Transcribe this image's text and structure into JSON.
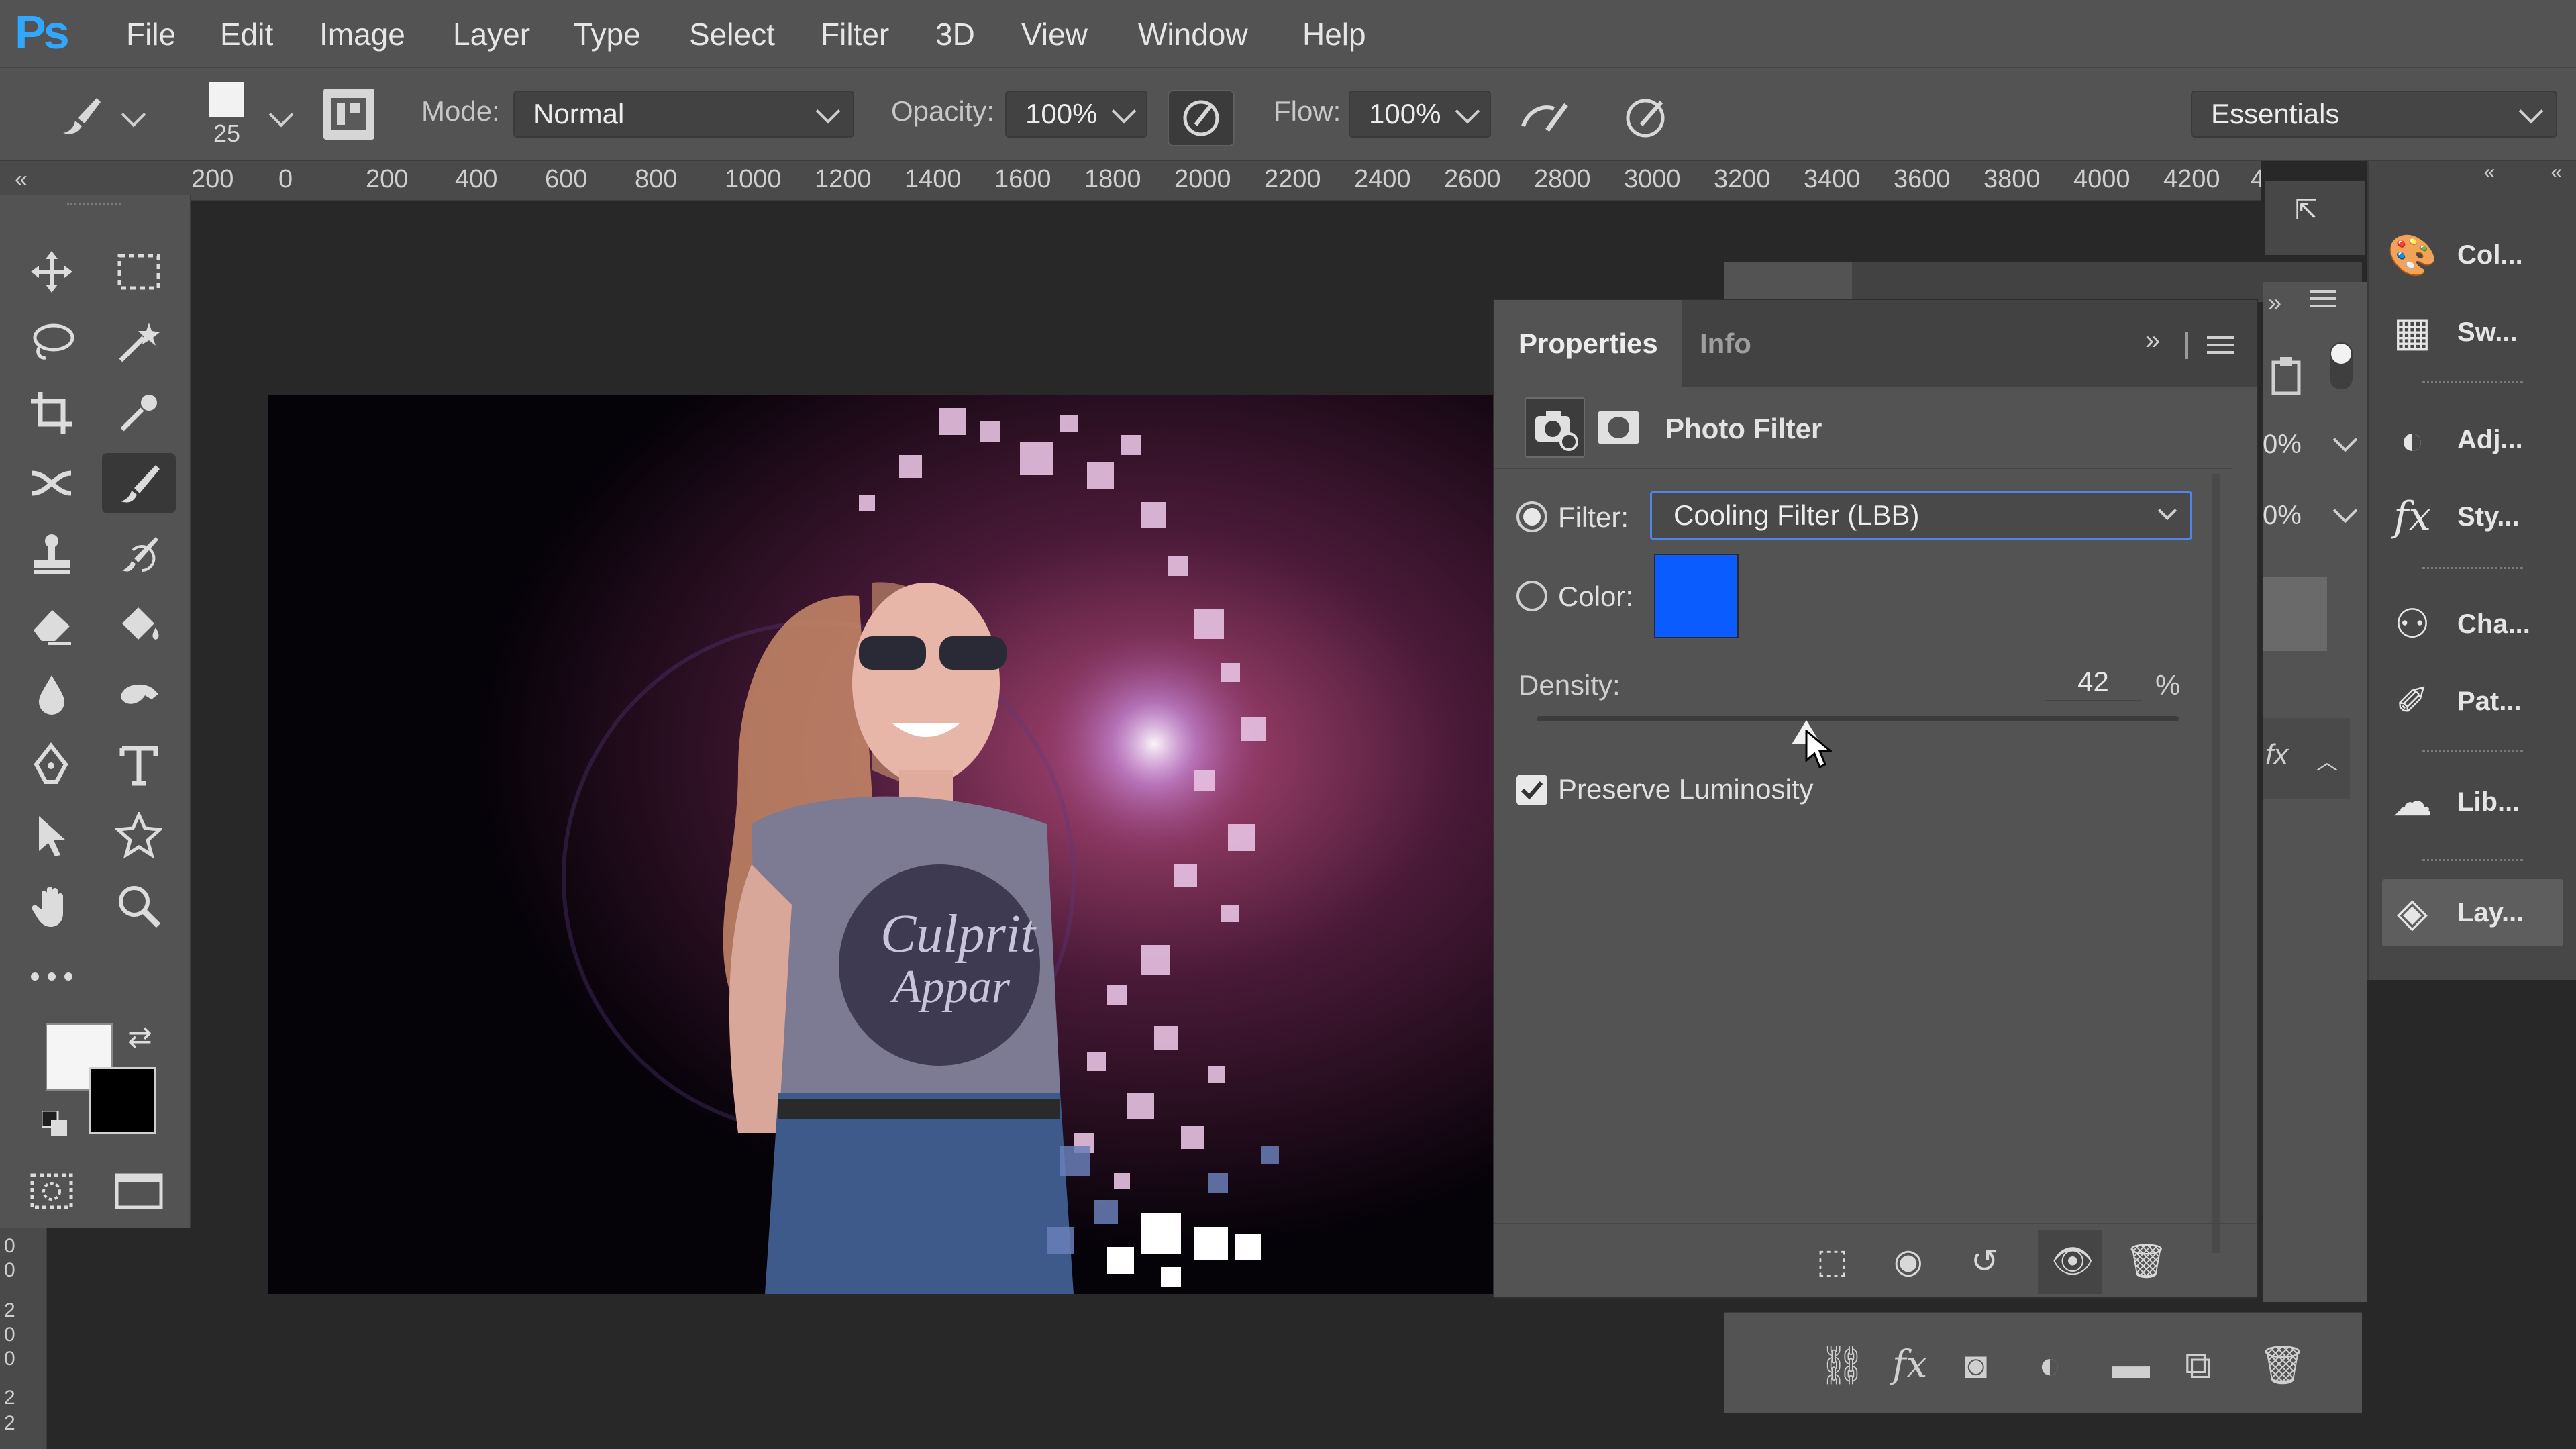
{
  "app": {
    "logo": "Ps"
  },
  "menu": [
    "File",
    "Edit",
    "Image",
    "Layer",
    "Type",
    "Select",
    "Filter",
    "3D",
    "View",
    "Window",
    "Help"
  ],
  "options_bar": {
    "brush_size": "25",
    "mode_label": "Mode:",
    "mode_value": "Normal",
    "opacity_label": "Opacity:",
    "opacity_value": "100%",
    "flow_label": "Flow:",
    "flow_value": "100%",
    "workspace": "Essentials"
  },
  "ruler": [
    "200",
    "0",
    "200",
    "400",
    "600",
    "800",
    "1000",
    "1200",
    "1400",
    "1600",
    "1800",
    "2000",
    "2200",
    "2400",
    "2600",
    "2800",
    "3000",
    "3200",
    "3400",
    "3600",
    "3800",
    "4000",
    "4200",
    "4"
  ],
  "ruler_left": [
    "0",
    "0",
    "2",
    "0",
    "0",
    "2",
    "2"
  ],
  "canvas": {
    "shirt_text": [
      "Culprit",
      "Appar"
    ]
  },
  "properties": {
    "tabs": [
      "Properties",
      "Info"
    ],
    "title": "Photo Filter",
    "filter_label": "Filter:",
    "filter_value": "Cooling Filter (LBB)",
    "color_label": "Color:",
    "color_swatch": "#0a5cff",
    "density_label": "Density:",
    "density_value": "42",
    "density_unit": "%",
    "density_fraction": 0.42,
    "preserve_label": "Preserve Luminosity",
    "preserve_checked": true
  },
  "layers_partial": {
    "opacity1": "0%",
    "opacity2": "0%",
    "fx": "fx"
  },
  "dock": [
    {
      "icon": "color-icon",
      "label": "Col..."
    },
    {
      "icon": "swatches-icon",
      "label": "Sw..."
    },
    {
      "icon": "adjustments-icon",
      "label": "Adj..."
    },
    {
      "icon": "styles-icon",
      "label": "Sty..."
    },
    {
      "icon": "channels-icon",
      "label": "Cha..."
    },
    {
      "icon": "paths-icon",
      "label": "Pat..."
    },
    {
      "icon": "libraries-icon",
      "label": "Lib..."
    },
    {
      "icon": "layers-icon",
      "label": "Lay..."
    }
  ]
}
